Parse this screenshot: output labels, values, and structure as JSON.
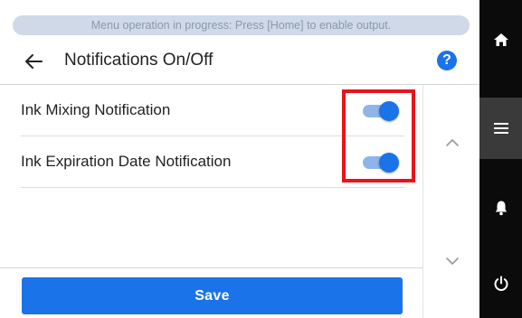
{
  "banner": {
    "text": "Menu operation in progress: Press [Home] to enable output."
  },
  "header": {
    "title": "Notifications On/Off",
    "back_icon": "arrow-left-icon",
    "help_icon": "help-icon",
    "help_glyph": "?"
  },
  "settings": [
    {
      "label": "Ink Mixing Notification",
      "state": "on"
    },
    {
      "label": "Ink Expiration Date Notification",
      "state": "on"
    }
  ],
  "scroll": {
    "up_icon": "chevron-up-icon",
    "down_icon": "chevron-down-icon"
  },
  "footer": {
    "save_label": "Save"
  },
  "navbar": {
    "items": [
      {
        "icon": "home-icon",
        "active": false
      },
      {
        "icon": "menu-icon",
        "active": true
      },
      {
        "icon": "bell-icon",
        "active": false
      },
      {
        "icon": "power-icon",
        "active": false
      }
    ]
  },
  "colors": {
    "accent": "#1a73e8",
    "banner_bg": "#cfd9e8",
    "highlight": "#e8141c",
    "navbar_bg": "#0b0b0b"
  }
}
